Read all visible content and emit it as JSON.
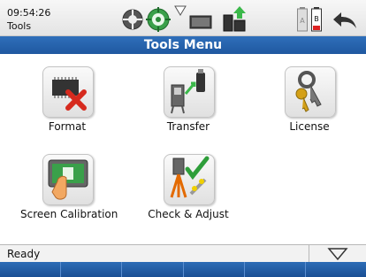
{
  "status": {
    "time": "09:54:26",
    "app_name": "Tools"
  },
  "title": "Tools Menu",
  "tools": [
    {
      "label": "Format",
      "icon": "format-chip-icon"
    },
    {
      "label": "Transfer",
      "icon": "transfer-icon"
    },
    {
      "label": "License",
      "icon": "license-keys-icon"
    },
    {
      "label": "Screen Calibration",
      "icon": "screen-calibration-icon"
    },
    {
      "label": "Check & Adjust",
      "icon": "check-adjust-icon"
    }
  ],
  "footer": {
    "status_text": "Ready"
  },
  "softkeys": [
    "",
    "",
    "",
    "",
    "",
    ""
  ],
  "colors": {
    "title_bar": "#2567ae",
    "softkey_bar": "#1f5ca6"
  }
}
